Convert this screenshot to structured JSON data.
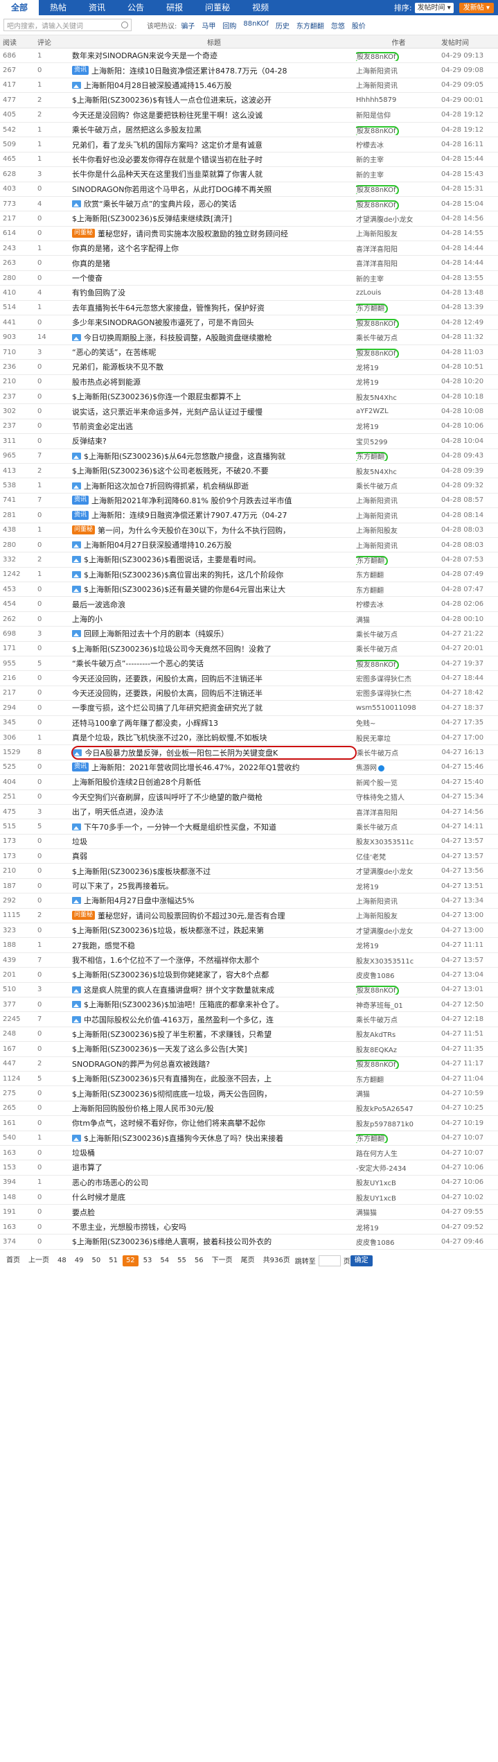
{
  "nav": {
    "tabs": [
      "全部",
      "热帖",
      "资讯",
      "公告",
      "研报",
      "问董秘",
      "视频"
    ],
    "active": 0,
    "sort_label": "排序:",
    "sort_value": "发帖时间",
    "post_button": "发新帖"
  },
  "search": {
    "placeholder": "吧内搜索，请输入关键词",
    "hot_label": "该吧热议:",
    "hot": [
      "骗子",
      "马甲",
      "回购",
      "88nKOf",
      "历史",
      "东方翻翻",
      "忽悠",
      "股价"
    ]
  },
  "columns": {
    "read": "阅读",
    "comment": "评论",
    "title": "标题",
    "author": "作者",
    "time": "发帖时间"
  },
  "rows": [
    {
      "read": "686",
      "cmt": "1",
      "tag": "",
      "title": "数年来对SINODRAGN来说今天是一个奇迹",
      "author": "股友88nKOf",
      "time": "04-29 09:13",
      "mark": "green"
    },
    {
      "read": "267",
      "cmt": "0",
      "tag": "news",
      "title": "上海新阳：连续10日融资净偿还累计8478.7万元（04-28",
      "author": "上海新阳资讯",
      "time": "04-29 09:08"
    },
    {
      "read": "417",
      "cmt": "1",
      "tag": "img",
      "title": "上海新阳04月28日被深股通减持15.46万股",
      "author": "上海新阳资讯",
      "time": "04-29 09:05"
    },
    {
      "read": "477",
      "cmt": "2",
      "tag": "",
      "title": "$上海新阳(SZ300236)$有钱人一点仓位进来玩，这波必开",
      "author": "Hhhhh5879",
      "time": "04-29 00:01"
    },
    {
      "read": "405",
      "cmt": "2",
      "tag": "",
      "title": "今天还是没回购？你这是要把铁粉往死里干啊！这么没诚",
      "author": "新阳是信仰",
      "time": "04-28 19:12"
    },
    {
      "read": "542",
      "cmt": "1",
      "tag": "",
      "title": "乘长牛破万点，居然把这么多股友拉黑",
      "author": "股友88nKOf",
      "time": "04-28 19:12",
      "mark": "green"
    },
    {
      "read": "509",
      "cmt": "1",
      "tag": "",
      "title": "兄弟们，看了龙头飞机的国际方案吗？这定价才是有诚意",
      "author": "柠檬去冰",
      "time": "04-28 16:11"
    },
    {
      "read": "465",
      "cmt": "1",
      "tag": "",
      "title": "长牛你看好也没必要发你得存在就是个错误当初在肚子时",
      "author": "新的主宰",
      "time": "04-28 15:44"
    },
    {
      "read": "628",
      "cmt": "3",
      "tag": "",
      "title": "长牛你是什么品种天天在这里我们当韭菜就算了你害人就",
      "author": "新的主宰",
      "time": "04-28 15:43"
    },
    {
      "read": "403",
      "cmt": "0",
      "tag": "",
      "title": "SINODRAGON你若用这个马甲名，从此打DOG棒不再关照",
      "author": "股友88nKOf",
      "time": "04-28 15:31",
      "mark": "green"
    },
    {
      "read": "773",
      "cmt": "4",
      "tag": "img",
      "title": "欣赏“乘长牛破万点”的宝典片段，恶心的笑话",
      "author": "股友88nKOf",
      "time": "04-28 15:04",
      "mark": "green"
    },
    {
      "read": "217",
      "cmt": "0",
      "tag": "",
      "title": "$上海新阳(SZ300236)$反弹结束继续跌[滴汗]",
      "author": "才望满腹de小龙女",
      "time": "04-28 14:56"
    },
    {
      "read": "614",
      "cmt": "0",
      "tag": "qa",
      "title": "董秘您好，请问贵司实施本次股权激励的独立财务顾问经",
      "author": "上海新阳股友",
      "time": "04-28 14:55"
    },
    {
      "read": "243",
      "cmt": "1",
      "tag": "",
      "title": "你真的是猪，这个名字配得上你",
      "author": "喜洋洋喜阳阳",
      "time": "04-28 14:44"
    },
    {
      "read": "263",
      "cmt": "0",
      "tag": "",
      "title": "你真的是猪",
      "author": "喜洋洋喜阳阳",
      "time": "04-28 14:44"
    },
    {
      "read": "280",
      "cmt": "0",
      "tag": "",
      "title": "一个傻奋",
      "author": "新的主宰",
      "time": "04-28 13:55"
    },
    {
      "read": "410",
      "cmt": "4",
      "tag": "",
      "title": "有钓鱼回购了没",
      "author": "zzLouis",
      "time": "04-28 13:48"
    },
    {
      "read": "514",
      "cmt": "1",
      "tag": "",
      "title": "去年直播狗长牛64元忽悠大家接盘，管惟狗托，保护好资",
      "author": "东方翻翻",
      "time": "04-28 13:39",
      "mark": "green"
    },
    {
      "read": "441",
      "cmt": "0",
      "tag": "",
      "title": "多少年来SINODRAGON被股市逼死了，可是不肯回头",
      "author": "股友88nKOf",
      "time": "04-28 12:49",
      "mark": "green"
    },
    {
      "read": "903",
      "cmt": "14",
      "tag": "img",
      "title": "今日切换周期股上涨，科技股调整，A股融资盘继续撤枪",
      "author": "乘长牛破万点",
      "time": "04-28 11:32"
    },
    {
      "read": "710",
      "cmt": "3",
      "tag": "",
      "title": "“恶心的笑话”，在苦练呢",
      "author": "股友88nKOf",
      "time": "04-28 11:03",
      "mark": "green"
    },
    {
      "read": "236",
      "cmt": "0",
      "tag": "",
      "title": "兄弟们，能源板块不见不散",
      "author": "龙将19",
      "time": "04-28 10:51"
    },
    {
      "read": "210",
      "cmt": "0",
      "tag": "",
      "title": "股市热点必将到能源",
      "author": "龙将19",
      "time": "04-28 10:20"
    },
    {
      "read": "237",
      "cmt": "0",
      "tag": "",
      "title": "$上海新阳(SZ300236)$你连一个跟屁虫都算不上",
      "author": "股友5N4Xhc",
      "time": "04-28 10:18"
    },
    {
      "read": "302",
      "cmt": "0",
      "tag": "",
      "title": "说实话，这只票近半来命运多舛，光刻产品认证过于缓慢",
      "author": "aYF2WZL",
      "time": "04-28 10:08"
    },
    {
      "read": "237",
      "cmt": "0",
      "tag": "",
      "title": "节前资金必定出逃",
      "author": "龙将19",
      "time": "04-28 10:06"
    },
    {
      "read": "311",
      "cmt": "0",
      "tag": "",
      "title": "反弹结束?",
      "author": "宝贝5299",
      "time": "04-28 10:04"
    },
    {
      "read": "965",
      "cmt": "7",
      "tag": "img",
      "title": "$上海新阳(SZ300236)$从64元忽悠散户接盘，这直播狗就",
      "author": "东方翻翻",
      "time": "04-28 09:43",
      "mark": "green"
    },
    {
      "read": "413",
      "cmt": "2",
      "tag": "",
      "title": "$上海新阳(SZ300236)$这个公司老板贱死，不破20.不要",
      "author": "股友5N4Xhc",
      "time": "04-28 09:39"
    },
    {
      "read": "538",
      "cmt": "1",
      "tag": "img",
      "title": "上海新阳这次加仓7折回购得抓紧，机会稍纵即逝",
      "author": "乘长牛破万点",
      "time": "04-28 09:32"
    },
    {
      "read": "741",
      "cmt": "7",
      "tag": "news",
      "title": "上海新阳2021年净利润降60.81% 股价9个月跌去过半市值",
      "author": "上海新阳资讯",
      "time": "04-28 08:57"
    },
    {
      "read": "281",
      "cmt": "0",
      "tag": "news",
      "title": "上海新阳：连续9日融资净偿还累计7907.47万元（04-27",
      "author": "上海新阳资讯",
      "time": "04-28 08:14"
    },
    {
      "read": "438",
      "cmt": "1",
      "tag": "qa",
      "title": "第一问，为什么今天股价在30以下，为什么不执行回购，",
      "author": "上海新阳股友",
      "time": "04-28 08:03"
    },
    {
      "read": "280",
      "cmt": "0",
      "tag": "img",
      "title": "上海新阳04月27日获深股通增持10.26万股",
      "author": "上海新阳资讯",
      "time": "04-28 08:03"
    },
    {
      "read": "332",
      "cmt": "2",
      "tag": "img",
      "title": "$上海新阳(SZ300236)$看图说话，主要是看时间。",
      "author": "东方翻翻",
      "time": "04-28 07:53",
      "mark": "green"
    },
    {
      "read": "1242",
      "cmt": "1",
      "tag": "img",
      "title": "$上海新阳(SZ300236)$高位冒出来的狗托，这几个阶段你",
      "author": "东方翻翻",
      "time": "04-28 07:49"
    },
    {
      "read": "453",
      "cmt": "0",
      "tag": "img",
      "title": "$上海新阳(SZ300236)$还有最关键的你是64元冒出来让大",
      "author": "东方翻翻",
      "time": "04-28 07:47"
    },
    {
      "read": "454",
      "cmt": "0",
      "tag": "",
      "title": "最后一波逃命浪",
      "author": "柠檬去冰",
      "time": "04-28 02:06"
    },
    {
      "read": "262",
      "cmt": "0",
      "tag": "",
      "title": "上海的小",
      "author": "满猫",
      "time": "04-28 00:10"
    },
    {
      "read": "698",
      "cmt": "3",
      "tag": "img",
      "title": "回顾上海新阳过去十个月的剧本（纯娱乐）",
      "author": "乘长牛破万点",
      "time": "04-27 21:22"
    },
    {
      "read": "171",
      "cmt": "0",
      "tag": "",
      "title": "$上海新阳(SZ300236)$垃圾公司今天竟然不回购！没救了",
      "author": "乘长牛破万点",
      "time": "04-27 20:01"
    },
    {
      "read": "955",
      "cmt": "5",
      "tag": "",
      "title": "“乘长牛破万点”---------一个恶心的笑话",
      "author": "股友88nKOf",
      "time": "04-27 19:37",
      "mark": "green"
    },
    {
      "read": "216",
      "cmt": "0",
      "tag": "",
      "title": "今天还没回购，还要跌，闲股价太高，回购后不注销还半",
      "author": "宏图多谋得狄仁杰",
      "time": "04-27 18:44"
    },
    {
      "read": "217",
      "cmt": "0",
      "tag": "",
      "title": "今天还没回购，还要跌，闲股价太高，回购后不注销还半",
      "author": "宏图多谋得狄仁杰",
      "time": "04-27 18:42"
    },
    {
      "read": "294",
      "cmt": "0",
      "tag": "",
      "title": "一季度亏损，这个烂公司搞了几年研究把资金研究光了就",
      "author": "wsm5510011098",
      "time": "04-27 18:37"
    },
    {
      "read": "345",
      "cmt": "0",
      "tag": "",
      "title": "还特马100拿了两年赚了都没卖，小辉辉13",
      "author": "免贱~",
      "time": "04-27 17:35"
    },
    {
      "read": "306",
      "cmt": "1",
      "tag": "",
      "title": "真是个垃圾，跌比飞机快涨不过20，涨比蚂蚁慢,不如板块",
      "author": "股民无辜垃",
      "time": "04-27 17:00"
    },
    {
      "read": "1529",
      "cmt": "8",
      "tag": "img",
      "title": "今日A股暴力放量反弹，创业板一阳包二长阴为关键变盘K",
      "author": "乘长牛破万点",
      "time": "04-27 16:13",
      "mark": "red"
    },
    {
      "read": "525",
      "cmt": "0",
      "tag": "news",
      "title": "上海新阳：2021年营收同比增长46.47%，2022年Q1营收约",
      "author": "焦游网",
      "time": "04-27 15:46",
      "verified": true
    },
    {
      "read": "404",
      "cmt": "0",
      "tag": "",
      "title": "上海新阳股价连续2日创逾28个月新低",
      "author": "新闻个股一览",
      "time": "04-27 15:40"
    },
    {
      "read": "251",
      "cmt": "0",
      "tag": "",
      "title": "今天空狗们兴奋刷屏，应该叫呼吁了不少绝望的散户徵枪",
      "author": "守株待免之猎人",
      "time": "04-27 15:34"
    },
    {
      "read": "475",
      "cmt": "3",
      "tag": "",
      "title": "出了，明天低点进，没办法",
      "author": "喜洋洋喜阳阳",
      "time": "04-27 14:56"
    },
    {
      "read": "515",
      "cmt": "5",
      "tag": "img",
      "title": "下午70多手一个，一分钟一个大概是组织性买盘，不知道",
      "author": "乘长牛破万点",
      "time": "04-27 14:11"
    },
    {
      "read": "173",
      "cmt": "0",
      "tag": "",
      "title": "垃圾",
      "author": "股友X30353511c",
      "time": "04-27 13:57"
    },
    {
      "read": "173",
      "cmt": "0",
      "tag": "",
      "title": "真弱",
      "author": "亿佳’老梵",
      "time": "04-27 13:57"
    },
    {
      "read": "210",
      "cmt": "0",
      "tag": "",
      "title": "$上海新阳(SZ300236)$废板块都涨不过",
      "author": "才望满腹de小龙女",
      "time": "04-27 13:56"
    },
    {
      "read": "187",
      "cmt": "0",
      "tag": "",
      "title": "可以下来了，25我再接着玩。",
      "author": "龙将19",
      "time": "04-27 13:51"
    },
    {
      "read": "292",
      "cmt": "0",
      "tag": "img",
      "title": "上海新阳4月27日盘中涨幅达5%",
      "author": "上海新阳资讯",
      "time": "04-27 13:34"
    },
    {
      "read": "1115",
      "cmt": "2",
      "tag": "qa",
      "title": "董秘您好，请问公司股票回购价不超过30元,是否有合理",
      "author": "上海新阳股友",
      "time": "04-27 13:00"
    },
    {
      "read": "323",
      "cmt": "0",
      "tag": "",
      "title": "$上海新阳(SZ300236)$垃圾，板块都涨不过，跌起来第",
      "author": "才望满腹de小龙女",
      "time": "04-27 13:00"
    },
    {
      "read": "188",
      "cmt": "1",
      "tag": "",
      "title": "27我跑，感觉不稳",
      "author": "龙将19",
      "time": "04-27 11:11"
    },
    {
      "read": "439",
      "cmt": "7",
      "tag": "",
      "title": "我不相信，1.6个亿拉不了一个涨停，不然福祥你太那个",
      "author": "股友X30353511c",
      "time": "04-27 13:57"
    },
    {
      "read": "201",
      "cmt": "0",
      "tag": "",
      "title": "$上海新阳(SZ300236)$垃圾到你姥姥家了，容大8个点都",
      "author": "皮皮鲁1086",
      "time": "04-27 13:04"
    },
    {
      "read": "510",
      "cmt": "3",
      "tag": "img",
      "title": "这是疯人院里的疯人在直播讲盘啊？拼个文字数量就来成",
      "author": "股友88nKOf",
      "time": "04-27 13:01",
      "mark": "green"
    },
    {
      "read": "377",
      "cmt": "0",
      "tag": "img",
      "title": "$上海新阳(SZ300236)$加油吧！压箱底的都拿来补仓了。",
      "author": "神奇茅班每_01",
      "time": "04-27 12:50"
    },
    {
      "read": "2245",
      "cmt": "7",
      "tag": "img",
      "title": "中芯国际股权公允价值-4163万，虽然盈利一个多亿，连",
      "author": "乘长牛破万点",
      "time": "04-27 12:18"
    },
    {
      "read": "248",
      "cmt": "0",
      "tag": "",
      "title": "$上海新阳(SZ300236)$投了半生积蓄，不求赚钱，只希望",
      "author": "股友AkdTRs",
      "time": "04-27 11:51"
    },
    {
      "read": "167",
      "cmt": "0",
      "tag": "",
      "title": "$上海新阳(SZ300236)$一天发了这么多公告[大笑]",
      "author": "股友8EQKAz",
      "time": "04-27 11:35"
    },
    {
      "read": "447",
      "cmt": "2",
      "tag": "",
      "title": "SNODRAGON的葬严为何总喜欢被践踏?",
      "author": "股友88nKOf",
      "time": "04-27 11:17",
      "mark": "green"
    },
    {
      "read": "1124",
      "cmt": "5",
      "tag": "",
      "title": "$上海新阳(SZ300236)$只有直播狗在，此股涨不回去，上",
      "author": "东方翻翻",
      "time": "04-27 11:04"
    },
    {
      "read": "275",
      "cmt": "0",
      "tag": "",
      "title": "$上海新阳(SZ300236)$彻彻底底一垃圾，两天公告回购，",
      "author": "满猫",
      "time": "04-27 10:59"
    },
    {
      "read": "265",
      "cmt": "0",
      "tag": "",
      "title": "上海新阳回购股份价格上限人民币30元/股",
      "author": "股友kPo5A26547",
      "time": "04-27 10:25"
    },
    {
      "read": "161",
      "cmt": "0",
      "tag": "",
      "title": "你tm争点气，这时候不看好你，你让他们将来高攀不起你",
      "author": "股友p5978871k0",
      "time": "04-27 10:19"
    },
    {
      "read": "540",
      "cmt": "1",
      "tag": "img",
      "title": "$上海新阳(SZ300236)$直播狗今天休息了吗？快出来接着",
      "author": "东方翻翻",
      "time": "04-27 10:07",
      "mark": "green"
    },
    {
      "read": "163",
      "cmt": "0",
      "tag": "",
      "title": "垃圾桶",
      "author": "路在何方人生",
      "time": "04-27 10:07"
    },
    {
      "read": "153",
      "cmt": "0",
      "tag": "",
      "title": "退市算了",
      "author": "-安定大师-2434",
      "time": "04-27 10:06"
    },
    {
      "read": "394",
      "cmt": "1",
      "tag": "",
      "title": "恶心的市场恶心的公司",
      "author": "股友UY1xcB",
      "time": "04-27 10:06"
    },
    {
      "read": "148",
      "cmt": "0",
      "tag": "",
      "title": "什么时候才是底",
      "author": "股友UY1xcB",
      "time": "04-27 10:02"
    },
    {
      "read": "191",
      "cmt": "0",
      "tag": "",
      "title": "要点脸",
      "author": "满猫猫",
      "time": "04-27 09:55"
    },
    {
      "read": "163",
      "cmt": "0",
      "tag": "",
      "title": "不思主业，光想股市捞钱，心安吗",
      "author": "龙将19",
      "time": "04-27 09:52"
    },
    {
      "read": "374",
      "cmt": "0",
      "tag": "",
      "title": "$上海新阳(SZ300236)$缘绝人寰啊，披着科技公司外衣的",
      "author": "皮皮鲁1086",
      "time": "04-27 09:46"
    }
  ],
  "pager": {
    "items": [
      "首页",
      "上一页",
      "48",
      "49",
      "50",
      "51",
      "52",
      "53",
      "54",
      "55",
      "56",
      "下一页",
      "尾页"
    ],
    "current": "52",
    "total": "共936页",
    "jump_label": "跳转至",
    "page_unit": "页",
    "ok": "确定"
  },
  "colors": {
    "brand": "#1e5eb3",
    "accent": "#f07a12",
    "news": "#3d8ee6",
    "mark_green": "#2bc62b",
    "mark_red": "#cc0f0f"
  }
}
